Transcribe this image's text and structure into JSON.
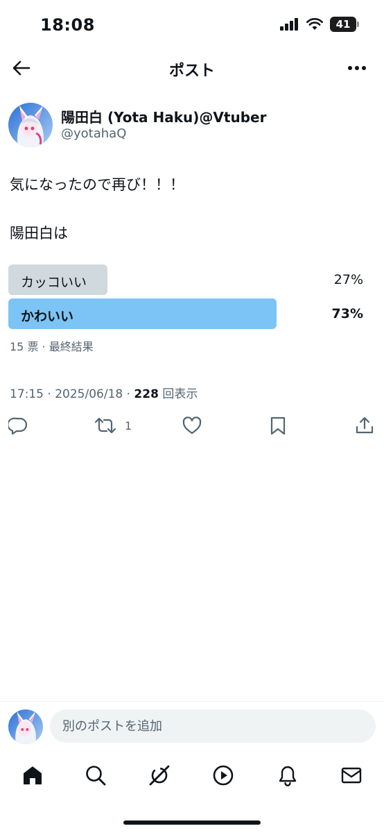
{
  "status_bar": {
    "time": "18:08",
    "battery": "41"
  },
  "header": {
    "title": "ポスト"
  },
  "author": {
    "display_name": "陽田白 (Yota Haku)@Vtuber",
    "handle": "@yotahaQ"
  },
  "tweet": {
    "lines": [
      "気になったので再び！！！",
      "陽田白は"
    ]
  },
  "poll": {
    "options": [
      {
        "label": "カッコいい",
        "percent": "27%",
        "fraction": 0.27
      },
      {
        "label": "かわいい",
        "percent": "73%",
        "fraction": 0.73
      }
    ],
    "votes": "15 票",
    "status": "最終結果"
  },
  "meta": {
    "time": "17:15",
    "date": "2025/06/18",
    "views": "228",
    "views_label": "回表示"
  },
  "actions": {
    "repost_count": "1"
  },
  "reply": {
    "placeholder": "別のポストを追加"
  },
  "colors": {
    "poll_winner": "#7cc4f5",
    "poll_other": "#cfd9de",
    "secondary_text": "#536471"
  }
}
